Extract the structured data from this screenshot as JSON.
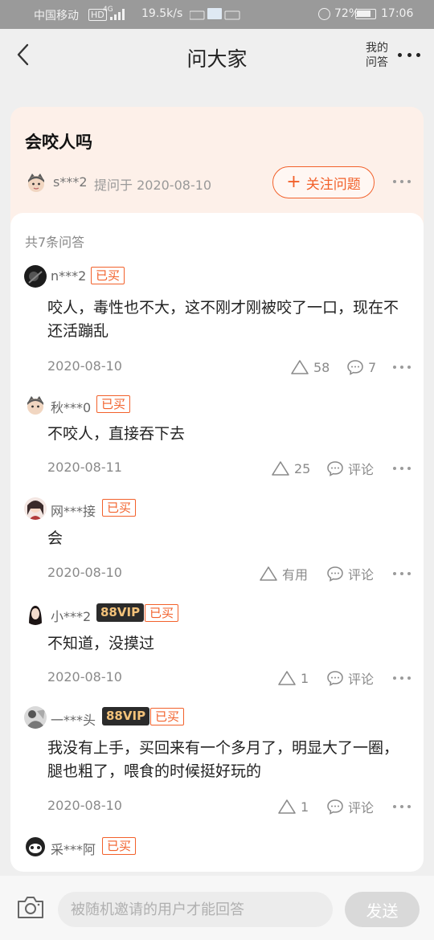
{
  "status_bar": {
    "carrier": "中国移动",
    "network_badge": "HD",
    "network_type": "4G",
    "speed": "19.5k/s",
    "battery": "72%",
    "time": "17:06"
  },
  "header": {
    "back_icon": "chevron-left-icon",
    "title": "问大家",
    "my_qa": "我的问答",
    "more_icon": "more-dots-icon"
  },
  "question": {
    "title": "会咬人吗",
    "asker": "s***2",
    "asked_at": "提问于 2020-08-10",
    "follow_label": "关注问题",
    "accent_color": "#f2612b"
  },
  "answers_header": {
    "count_label": "共7条问答"
  },
  "answers": [
    {
      "user": "n***2",
      "vip": "",
      "bought": "已买",
      "text": "咬人，毒性也不大，这不刚才刚被咬了一口，现在不还活蹦乱",
      "date": "2020-08-10",
      "likes": "58",
      "comments": "7"
    },
    {
      "user": "秋***0",
      "vip": "",
      "bought": "已买",
      "text": "不咬人，直接吞下去",
      "date": "2020-08-11",
      "likes": "25",
      "comments": "评论"
    },
    {
      "user": "网***接",
      "vip": "",
      "bought": "已买",
      "text": "会",
      "date": "2020-08-10",
      "likes": "有用",
      "comments": "评论"
    },
    {
      "user": "小***2",
      "vip": "88VIP",
      "bought": "已买",
      "text": "不知道，没摸过",
      "date": "2020-08-10",
      "likes": "1",
      "comments": "评论"
    },
    {
      "user": "一***头",
      "vip": "88VIP",
      "bought": "已买",
      "text": "我没有上手，买回来有一个多月了，明显大了一圈，腿也粗了，喂食的时候挺好玩的",
      "date": "2020-08-10",
      "likes": "1",
      "comments": "评论"
    },
    {
      "user": "采***阿",
      "vip": "",
      "bought": "已买"
    }
  ],
  "bottom_bar": {
    "camera_icon": "camera-icon",
    "input_placeholder": "被随机邀请的用户才能回答",
    "send_label": "发送"
  }
}
